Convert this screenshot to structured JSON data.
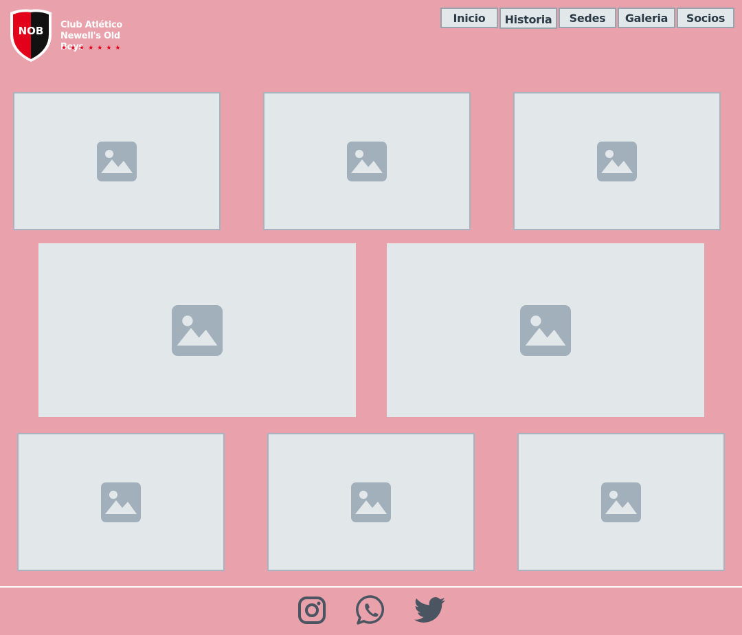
{
  "brand": {
    "line1": "Club Atlético",
    "line2": "Newell's Old Boys",
    "abbr": "NOB",
    "stars": "★★★★★★★"
  },
  "nav": {
    "items": [
      {
        "label": "Inicio"
      },
      {
        "label": "Historia"
      },
      {
        "label": "Sedes"
      },
      {
        "label": "Galeria"
      },
      {
        "label": "Socios"
      }
    ]
  },
  "gallery": {
    "image_count": 8,
    "icon": "image-placeholder-icon"
  },
  "footer": {
    "socials": [
      {
        "icon": "instagram-icon"
      },
      {
        "icon": "whatsapp-icon"
      },
      {
        "icon": "twitter-icon"
      }
    ]
  },
  "colors": {
    "background": "#e9a2ab",
    "card": "#e2e7ea",
    "card_border": "#a7b4bf",
    "icon": "#a2b0bc",
    "social_icon": "#4a5561",
    "brand_red": "#e2001a",
    "brand_black": "#111111"
  }
}
